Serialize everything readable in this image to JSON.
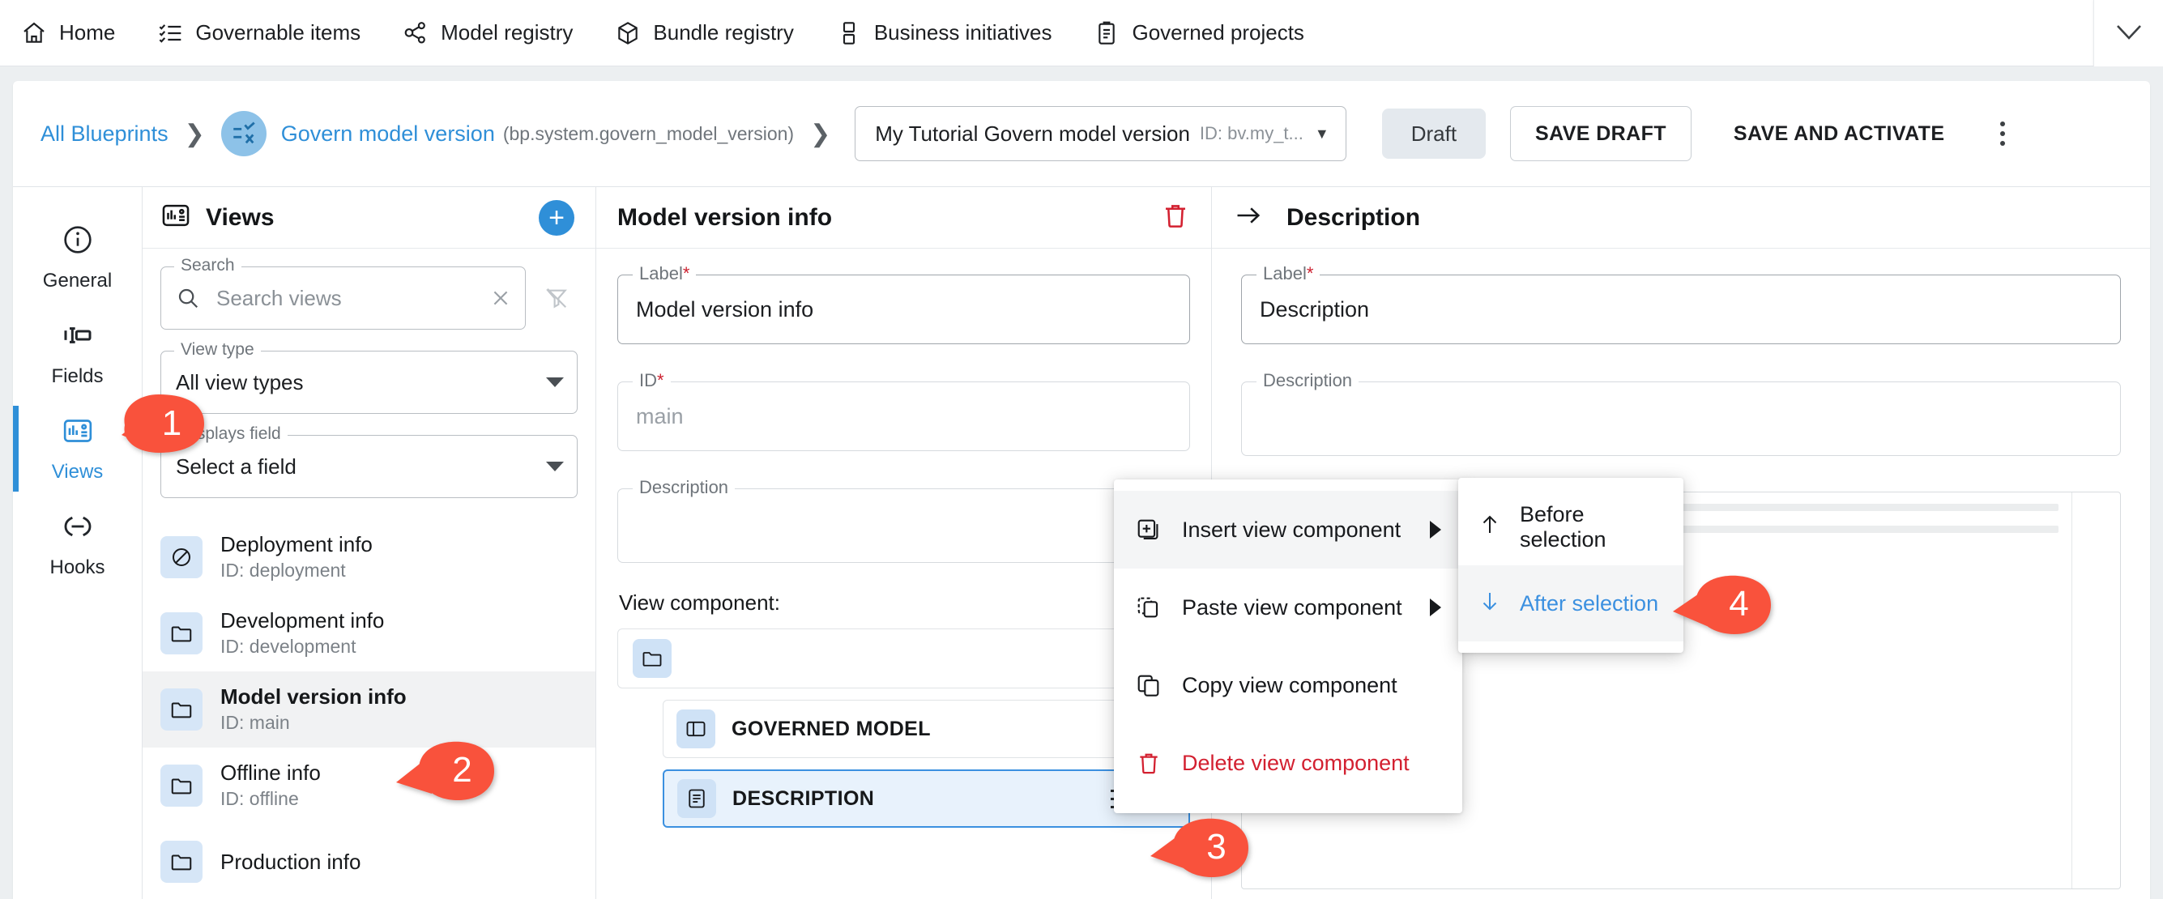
{
  "topnav": {
    "items": [
      {
        "label": "Home",
        "icon": "home-icon"
      },
      {
        "label": "Governable items",
        "icon": "checklist-icon"
      },
      {
        "label": "Model registry",
        "icon": "model-registry-icon"
      },
      {
        "label": "Bundle registry",
        "icon": "cube-icon"
      },
      {
        "label": "Business initiatives",
        "icon": "initiatives-icon"
      },
      {
        "label": "Governed projects",
        "icon": "clipboard-icon"
      }
    ],
    "collapse_icon": "chevron-down-icon"
  },
  "toolbar": {
    "all_blueprints": "All Blueprints",
    "blueprint_name": "Govern model version",
    "blueprint_id": "(bp.system.govern_model_version)",
    "version_name": "My Tutorial Govern model version",
    "version_id": "ID: bv.my_t...",
    "status_chip": "Draft",
    "save_draft": "SAVE DRAFT",
    "save_and_activate": "SAVE AND ACTIVATE",
    "more_icon": "kebab-menu-icon"
  },
  "rail": {
    "items": [
      {
        "label": "General",
        "icon": "info-circle-icon",
        "active": false
      },
      {
        "label": "Fields",
        "icon": "fields-icon",
        "active": false
      },
      {
        "label": "Views",
        "icon": "views-icon",
        "active": true
      },
      {
        "label": "Hooks",
        "icon": "hooks-icon",
        "active": false
      }
    ]
  },
  "views_panel": {
    "title": "Views",
    "title_icon": "views-icon",
    "add_icon": "plus-icon",
    "search": {
      "legend": "Search",
      "placeholder": "Search views",
      "value": "",
      "clear_icon": "close-icon",
      "search_icon": "search-icon"
    },
    "filter_off_icon": "filter-off-icon",
    "view_type": {
      "legend": "View type",
      "value": "All view types"
    },
    "displays_field": {
      "legend": "Displays field",
      "value": "Select a field"
    },
    "items": [
      {
        "name": "Deployment info",
        "id": "ID: deployment",
        "icon": "no-folder-icon",
        "selected": false
      },
      {
        "name": "Development info",
        "id": "ID: development",
        "icon": "folder-icon",
        "selected": false
      },
      {
        "name": "Model version info",
        "id": "ID: main",
        "icon": "folder-icon",
        "selected": true
      },
      {
        "name": "Offline info",
        "id": "ID: offline",
        "icon": "folder-icon",
        "selected": false
      },
      {
        "name": "Production info",
        "id": "",
        "icon": "folder-icon",
        "selected": false
      }
    ]
  },
  "center_panel": {
    "title": "Model version info",
    "delete_icon": "trash-icon",
    "label_field": {
      "legend": "Label",
      "required": "*",
      "value": "Model version info"
    },
    "id_field": {
      "legend": "ID",
      "required": "*",
      "placeholder": "main"
    },
    "description_field": {
      "legend": "Description",
      "value": ""
    },
    "view_component_label": "View component:",
    "tree": {
      "root_icon": "folder-icon",
      "children": [
        {
          "name": "GOVERNED MODEL",
          "icon": "panel-icon",
          "active": false
        },
        {
          "name": "DESCRIPTION",
          "icon": "document-icon",
          "active": true
        }
      ]
    }
  },
  "right_panel": {
    "back_icon": "arrow-right-icon",
    "title": "Description",
    "label_field": {
      "legend": "Label",
      "required": "*",
      "value": "Description"
    },
    "description_field": {
      "legend": "Description",
      "value": ""
    }
  },
  "context_menu": {
    "items": [
      {
        "label": "Insert view component",
        "icon": "insert-icon",
        "submenu": true,
        "highlight": true,
        "danger": false
      },
      {
        "label": "Paste view component",
        "icon": "paste-icon",
        "submenu": true,
        "highlight": false,
        "danger": false
      },
      {
        "label": "Copy view component",
        "icon": "copy-icon",
        "submenu": false,
        "highlight": false,
        "danger": false
      },
      {
        "label": "Delete view component",
        "icon": "trash-icon",
        "submenu": false,
        "highlight": false,
        "danger": true
      }
    ]
  },
  "sub_menu": {
    "items": [
      {
        "label": "Before selection",
        "icon": "arrow-up-icon",
        "highlight": false
      },
      {
        "label": "After selection",
        "icon": "arrow-down-icon",
        "highlight": true
      }
    ]
  },
  "callouts": [
    {
      "number": "1"
    },
    {
      "number": "2"
    },
    {
      "number": "3"
    },
    {
      "number": "4"
    }
  ],
  "colors": {
    "accent_blue": "#2f8fd8",
    "callout_red": "#f9523c",
    "danger_red": "#d32030",
    "page_bg": "#eceff1"
  }
}
